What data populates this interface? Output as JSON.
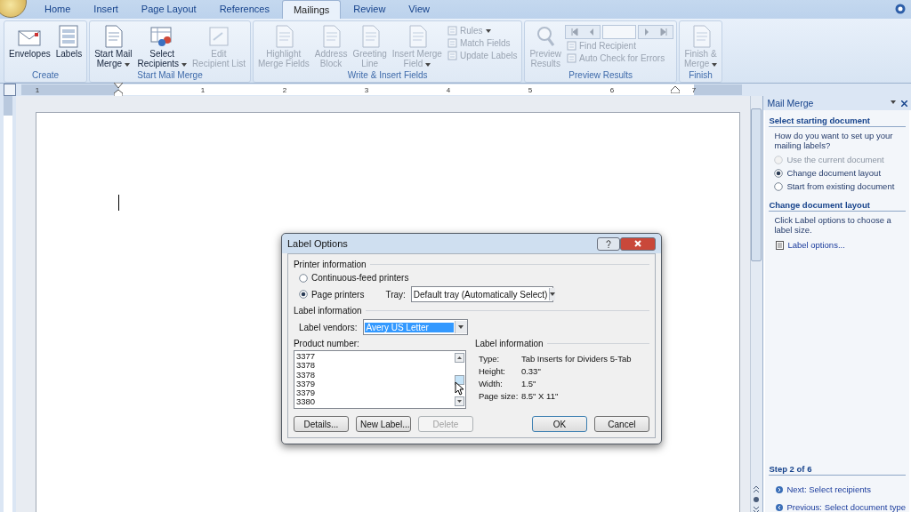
{
  "tabs": [
    {
      "label": "Home",
      "selected": false
    },
    {
      "label": "Insert",
      "selected": false
    },
    {
      "label": "Page Layout",
      "selected": false
    },
    {
      "label": "References",
      "selected": false
    },
    {
      "label": "Mailings",
      "selected": true
    },
    {
      "label": "Review",
      "selected": false
    },
    {
      "label": "View",
      "selected": false
    }
  ],
  "ribbon": {
    "groups": [
      {
        "label": "Create",
        "items": [
          {
            "kind": "large",
            "lines": [
              "Envelopes"
            ],
            "disabled": false,
            "has_menu": false
          },
          {
            "kind": "large",
            "lines": [
              "Labels"
            ],
            "disabled": false,
            "has_menu": false
          }
        ]
      },
      {
        "label": "Start Mail Merge",
        "items": [
          {
            "kind": "large",
            "lines": [
              "Start Mail",
              "Merge"
            ],
            "disabled": false,
            "has_menu": true
          },
          {
            "kind": "large",
            "lines": [
              "Select",
              "Recipients"
            ],
            "disabled": false,
            "has_menu": true
          },
          {
            "kind": "large",
            "lines": [
              "Edit",
              "Recipient List"
            ],
            "disabled": true,
            "has_menu": false
          }
        ]
      },
      {
        "label": "Write & Insert Fields",
        "items": [
          {
            "kind": "large",
            "lines": [
              "Highlight",
              "Merge Fields"
            ],
            "disabled": true,
            "has_menu": false
          },
          {
            "kind": "large",
            "lines": [
              "Address",
              "Block"
            ],
            "disabled": true,
            "has_menu": false
          },
          {
            "kind": "large",
            "lines": [
              "Greeting",
              "Line"
            ],
            "disabled": true,
            "has_menu": false
          },
          {
            "kind": "large",
            "lines": [
              "Insert Merge",
              "Field"
            ],
            "disabled": true,
            "has_menu": true
          },
          {
            "kind": "stack",
            "items": [
              {
                "label": "Rules",
                "disabled": true,
                "has_menu": true
              },
              {
                "label": "Match Fields",
                "disabled": true,
                "has_menu": false
              },
              {
                "label": "Update Labels",
                "disabled": true,
                "has_menu": false
              }
            ]
          }
        ]
      },
      {
        "label": "Preview Results",
        "items": [
          {
            "kind": "large",
            "lines": [
              "Preview",
              "Results"
            ],
            "disabled": true,
            "has_menu": false
          },
          {
            "kind": "navstack",
            "items": [
              {
                "label": "Find Recipient",
                "disabled": true,
                "has_menu": false
              },
              {
                "label": "Auto Check for Errors",
                "disabled": true,
                "has_menu": false
              }
            ]
          }
        ]
      },
      {
        "label": "Finish",
        "items": [
          {
            "kind": "large",
            "lines": [
              "Finish &",
              "Merge"
            ],
            "disabled": true,
            "has_menu": true
          }
        ]
      }
    ]
  },
  "ruler": {
    "numbers": [
      "1",
      "1",
      "2",
      "3",
      "4",
      "5",
      "6",
      "7"
    ]
  },
  "dialog": {
    "title": "Label Options",
    "printer_section": {
      "title": "Printer information",
      "options": [
        {
          "label": "Continuous-feed printers",
          "selected": false
        },
        {
          "label": "Page printers",
          "selected": true
        }
      ],
      "tray_label": "Tray:",
      "tray_value": "Default tray (Automatically Select)"
    },
    "label_section": {
      "title": "Label information",
      "vendors_label": "Label vendors:",
      "vendors_value": "Avery US Letter"
    },
    "product_list": {
      "title": "Product number:",
      "items": [
        "3377",
        "3378",
        "3378",
        "3379",
        "3379",
        "3380"
      ]
    },
    "info": {
      "title": "Label information",
      "rows": [
        {
          "key": "Type:",
          "value": "Tab Inserts for Dividers 5-Tab"
        },
        {
          "key": "Height:",
          "value": "0.33\""
        },
        {
          "key": "Width:",
          "value": "1.5\""
        },
        {
          "key": "Page size:",
          "value": "8.5\" X 11\""
        }
      ]
    },
    "buttons": [
      {
        "label": "Details...",
        "disabled": false,
        "default": false
      },
      {
        "label": "New Label...",
        "disabled": false,
        "default": false
      },
      {
        "label": "Delete",
        "disabled": true,
        "default": false
      },
      {
        "label": "OK",
        "disabled": false,
        "default": true
      },
      {
        "label": "Cancel",
        "disabled": false,
        "default": false
      }
    ]
  },
  "task_pane": {
    "title": "Mail Merge",
    "section1": {
      "heading": "Select starting document",
      "prompt": "How do you want to set up your mailing labels?",
      "options": [
        {
          "label": "Use the current document",
          "selected": false,
          "disabled": true
        },
        {
          "label": "Change document layout",
          "selected": true,
          "disabled": false
        },
        {
          "label": "Start from existing document",
          "selected": false,
          "disabled": false
        }
      ]
    },
    "section2": {
      "heading": "Change document layout",
      "text": "Click Label options to choose a label size.",
      "link": "Label options..."
    },
    "step": {
      "heading": "Step 2 of 6",
      "links": [
        {
          "kind": "next",
          "label": "Next: Select recipients"
        },
        {
          "kind": "previous",
          "label": "Previous: Select document type"
        }
      ]
    }
  }
}
